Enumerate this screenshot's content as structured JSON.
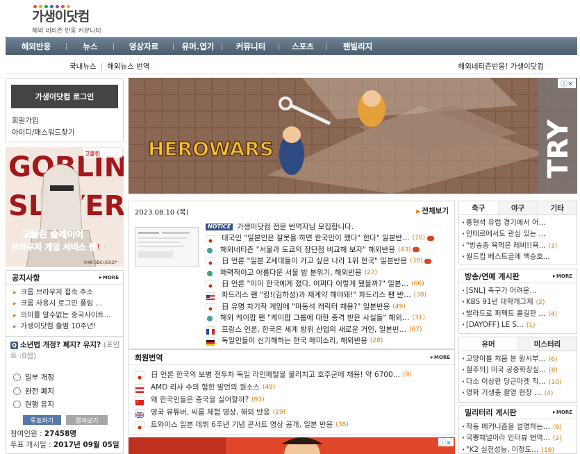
{
  "site": {
    "logo_title": "가생이닷컴",
    "logo_subtitle": "해외 네티즌 반응 커뮤니티",
    "logo_dot_colors": [
      "#e94b3c",
      "#f5a623",
      "#2a9d4b",
      "#2b6cc4",
      "#8e44ad",
      "#e94b3c",
      "#f5a623"
    ]
  },
  "gnb": [
    "해외반응",
    "뉴스",
    "영상자료",
    "유머.엽기",
    "커뮤니티",
    "스포츠",
    "팬빌리지"
  ],
  "subnav": {
    "left": [
      "국내뉴스",
      "해외뉴스 번역"
    ],
    "right": "해외네티즌반응! 가생이닷컴"
  },
  "login": {
    "button": "가생이닷컴 로그인",
    "join": "회원가입",
    "find": "아이디/패스워드찾기"
  },
  "goblin_ad": {
    "title_lines": [
      "GOBLIN",
      "SLAYER"
    ],
    "badge": "고블린",
    "caption_lines": [
      "고블린 슬레이어",
      "브라우저 게임 서비스 중!"
    ],
    "credit": "©KK·SBCr/GS2P"
  },
  "notice": {
    "title": "공지사항",
    "more": "MORE",
    "items": [
      "크롬 브라우저 접속 주소",
      "크롬 사용시 로그인 풀림 ...",
      "의미를 알수없는 중국사이트...",
      "가생이닷컴 출범 10주년!"
    ]
  },
  "poll": {
    "question": "소년법 개정? 폐지? 유지?",
    "points": "(포인트 :0점)",
    "options": [
      "일부 개정",
      "완전 폐지",
      "현행 유지"
    ],
    "vote_button": "투표하기",
    "result_button": "결과보기",
    "participants_label": "참여인원 : ",
    "participants_value": "27458명",
    "start_label": "투표 개시일 : ",
    "start_value": "2017년 09월 05일"
  },
  "hero_ad": {
    "logo": "HEROWARS",
    "cta": "TRY"
  },
  "news": {
    "date": "2023.08.10 (목)",
    "view_all": "전체보기",
    "items": [
      {
        "flag": "notice",
        "badge": "NOTICE",
        "title": "가생이닷컴 전문 번역자님 모집합니다.",
        "count": "",
        "hot": false
      },
      {
        "flag": "jp",
        "badge": "",
        "title": "태국인 \"일본인은 잘못을 하면 한국인이 했다\" 한다\" 일본반…",
        "count": "(70)",
        "hot": true
      },
      {
        "flag": "globe",
        "badge": "",
        "title": "해외네티즌 \"서울과 도쿄의 장단점 비교해 보자\" 해외반응",
        "count": "(43)",
        "hot": true
      },
      {
        "flag": "jp",
        "badge": "",
        "title": "日 언론 \"일본 Z세대들이 가고 싶은 나라 1위 한국\" 일본반응",
        "count": "(38)",
        "hot": true
      },
      {
        "flag": "globe",
        "badge": "",
        "title": "매력적이고 아름다운 서울 밤 분위기, 해외반응",
        "count": "(27)",
        "hot": false
      },
      {
        "flag": "jp",
        "badge": "",
        "title": "日 언론 \"이미 한국에게 졌다. 어쩌다 이렇게 됐을까?\" 일본…",
        "count": "(66)",
        "hot": false
      },
      {
        "flag": "us",
        "badge": "",
        "title": "파드리스 팬 \"킹!(김하성)과 재계약 해야돼!\" 파드리스 팬 반…",
        "count": "(38)",
        "hot": false
      },
      {
        "flag": "jp",
        "badge": "",
        "title": "日 유명 차기작 게임에 \"마동석 캐릭터 채용?\" 일본반응",
        "count": "(49)",
        "hot": false
      },
      {
        "flag": "globe",
        "badge": "",
        "title": "해외 케이팝 팬 \"케이팝 그룹에 대한 충격 받은 사실들\" 해외…",
        "count": "(31)",
        "hot": false
      },
      {
        "flag": "fr",
        "badge": "",
        "title": "프랑스 언론, 한국은 세계 방위 산업의 새로운 거인, 일본반…",
        "count": "(67)",
        "hot": false
      },
      {
        "flag": "de",
        "badge": "",
        "title": "독일인들이 신기해하는 한국 매미소리, 해외반응",
        "count": "(28)",
        "hot": false
      }
    ]
  },
  "member": {
    "title": "회원번역",
    "more": "MORE",
    "items": [
      {
        "flag": "jp",
        "title": "日 언론 한국의 보병 전투차 독일 라인메탈을 물리치고 호주군에 채용! 약 6700…",
        "count": "(9)"
      },
      {
        "flag": "at",
        "title": "AMD 리사 수의 혐한 발언의 원소스",
        "count": "(49)"
      },
      {
        "flag": "cn",
        "title": "왜 한국인들은 중국을 싫어할까?",
        "count": "(93)"
      },
      {
        "flag": "uk",
        "title": "영국 유튜버, 씨름 체험 영상, 해외 반응",
        "count": "(19)"
      },
      {
        "flag": "jp",
        "title": "트와이스 일본 데뷔 6주년 기념 콘서트 영상 공개, 일본 반응",
        "count": "(38)"
      }
    ]
  },
  "sports": {
    "tabs": [
      "축구",
      "야구",
      "기타"
    ],
    "items": [
      {
        "text": "홍현석 유럽 경기에서 어…",
        "count": ""
      },
      {
        "text": "인테르에서도 관심 있는 ...",
        "count": ""
      },
      {
        "text": "\"방송중 욕먹은 레비!!욕...",
        "count": "(3)"
      },
      {
        "text": "월드컵 베스트골에 백승호...",
        "count": ""
      }
    ]
  },
  "celeb": {
    "title": "방송/연예 게시판",
    "more": "MORE",
    "items": [
      {
        "text": "[SNL] 축구가 어려운…",
        "count": ""
      },
      {
        "text": "KBS 91년 대학개그제",
        "count": "(2)"
      },
      {
        "text": "발라드로 퍼펙트 흘길한 ...",
        "count": "(4)"
      },
      {
        "text": "[DAYOFF] LE S...",
        "count": "(1)"
      }
    ]
  },
  "humor": {
    "tabs": [
      "유머",
      "미스터리"
    ],
    "items": [
      {
        "text": "고양이를 처음 본 원시부…",
        "count": "(6)"
      },
      {
        "text": "헐주의] 미국 공중화장실...",
        "count": "(8)"
      },
      {
        "text": "다소 이상한 당근마켓 직…",
        "count": "(10)"
      },
      {
        "text": "영화 기생충 촬영 현장 …",
        "count": "(4)"
      }
    ]
  },
  "military": {
    "title": "밀리터리 게시판",
    "more": "MORE",
    "items": [
      {
        "text": "작동 메커니즘을 설명하는…",
        "count": "(6)"
      },
      {
        "text": "국뽕채널이라 인터뷰 번역…",
        "count": "(2)"
      },
      {
        "text": "\"K2 실전성능, 이정도…",
        "count": "(18)"
      }
    ]
  },
  "colors": {
    "accent_orange": "#e07b00",
    "nav_blue": "#4a5d6e",
    "notice_badge": "#334e8e"
  }
}
